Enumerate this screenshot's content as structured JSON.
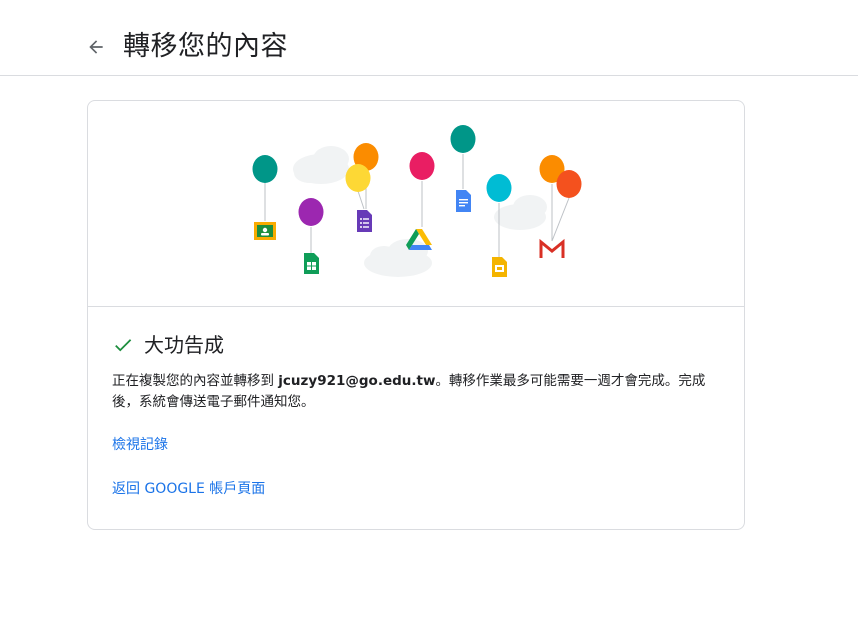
{
  "header": {
    "back_icon": "arrow-left-icon",
    "title": "轉移您的內容"
  },
  "status": {
    "icon": "checkmark-icon",
    "icon_color": "#1e8e3e",
    "title": "大功告成"
  },
  "message": {
    "part1": "正在複製您的內容並轉移到 ",
    "email": "jcuzy921@go.edu.tw",
    "part2": "。轉移作業最多可能需要一週才會完成。完成後，系統會傳送電子郵件通知您。"
  },
  "links": {
    "history": "檢視記錄",
    "back_to_account": "返回 GOOGLE 帳戶頁面"
  },
  "colors": {
    "link": "#1a73e8",
    "border": "#dadce0"
  },
  "illustration": {
    "icons": [
      "classroom-icon",
      "sheets-icon",
      "forms-icon",
      "drive-icon",
      "docs-icon",
      "slides-icon",
      "gmail-icon"
    ]
  }
}
